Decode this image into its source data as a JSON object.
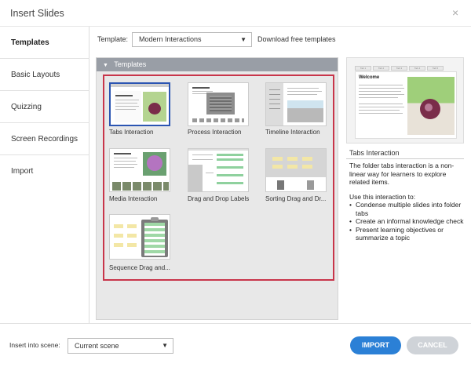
{
  "window": {
    "title": "Insert Slides",
    "close_glyph": "×"
  },
  "sidebar": {
    "items": [
      {
        "label": "Templates",
        "active": true
      },
      {
        "label": "Basic Layouts",
        "active": false
      },
      {
        "label": "Quizzing",
        "active": false
      },
      {
        "label": "Screen Recordings",
        "active": false
      },
      {
        "label": "Import",
        "active": false
      }
    ]
  },
  "toolbar": {
    "template_label": "Template:",
    "template_value": "Modern Interactions",
    "download_link": "Download free templates"
  },
  "panel": {
    "header": "Templates",
    "items": [
      {
        "label": "Tabs Interaction",
        "selected": true
      },
      {
        "label": "Process Interaction",
        "selected": false
      },
      {
        "label": "Timeline Interaction",
        "selected": false
      },
      {
        "label": "Media Interaction",
        "selected": false
      },
      {
        "label": "Drag and Drop Labels",
        "selected": false
      },
      {
        "label": "Sorting Drag and Dr...",
        "selected": false
      },
      {
        "label": "Sequence Drag and...",
        "selected": false
      }
    ]
  },
  "preview": {
    "welcome": "Welcome",
    "tab_labels": [
      "Tab 1",
      "Tab 2",
      "Tab 3",
      "Tab 4",
      "Tab 5"
    ]
  },
  "info": {
    "title": "Tabs Interaction",
    "description": "The folder tabs interaction is a non-linear way for learners to explore related items.",
    "use_intro": "Use this interaction to:",
    "bullets": [
      "Condense multiple slides into folder tabs",
      "Create an informal knowledge check",
      "Present learning objectives or summarize a topic"
    ]
  },
  "footer": {
    "insert_label": "Insert into scene:",
    "scene_value": "Current scene",
    "import_label": "IMPORT",
    "cancel_label": "CANCEL"
  },
  "colors": {
    "accent": "#2b80d6",
    "selection": "#2b55b2",
    "grid_border": "#c8354a",
    "panel_header": "#999ea6"
  },
  "icons": {
    "dropdown": "chevron-down-icon",
    "collapse": "triangle-down-icon",
    "close": "close-icon"
  }
}
